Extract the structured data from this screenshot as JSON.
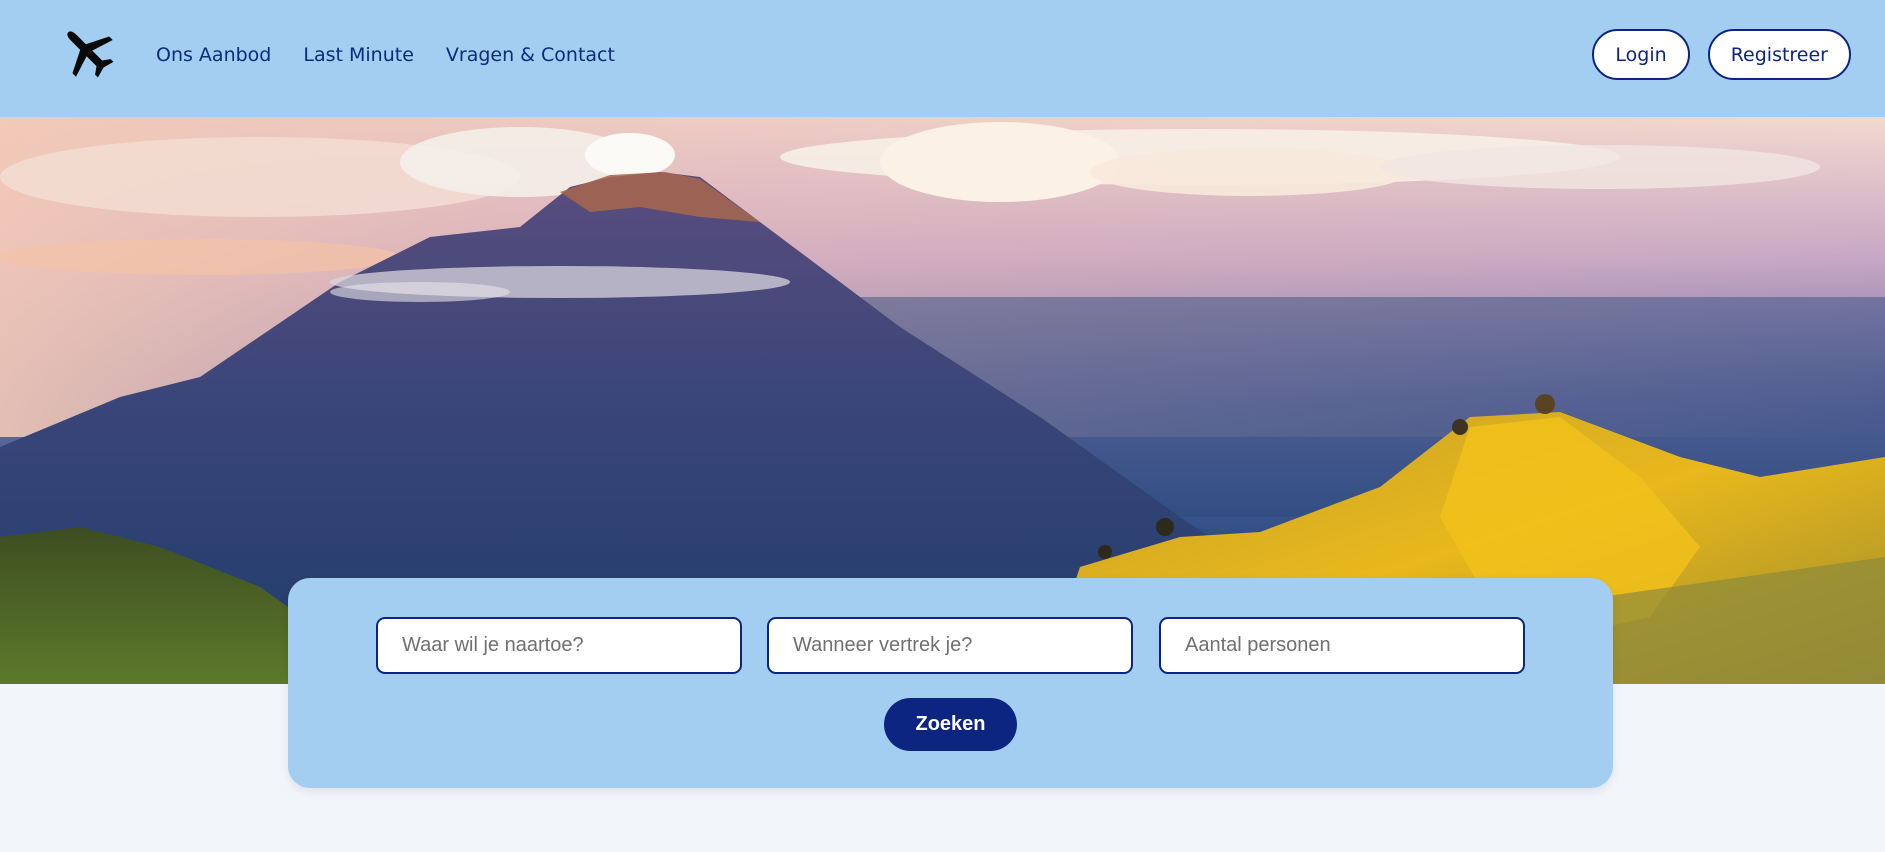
{
  "header": {
    "logo_icon": "airplane-icon",
    "nav": [
      {
        "label": "Ons Aanbod"
      },
      {
        "label": "Last Minute"
      },
      {
        "label": "Vragen & Contact"
      }
    ],
    "login_label": "Login",
    "register_label": "Registreer"
  },
  "hero": {
    "image": "volcano-landscape"
  },
  "search": {
    "destination_placeholder": "Waar wil je naartoe?",
    "date_placeholder": "Wanneer vertrek je?",
    "persons_placeholder": "Aantal personen",
    "submit_label": "Zoeken"
  },
  "colors": {
    "header_bg": "#a3cdf1",
    "primary": "#0b2580",
    "page_bg": "#f2f6fb"
  }
}
